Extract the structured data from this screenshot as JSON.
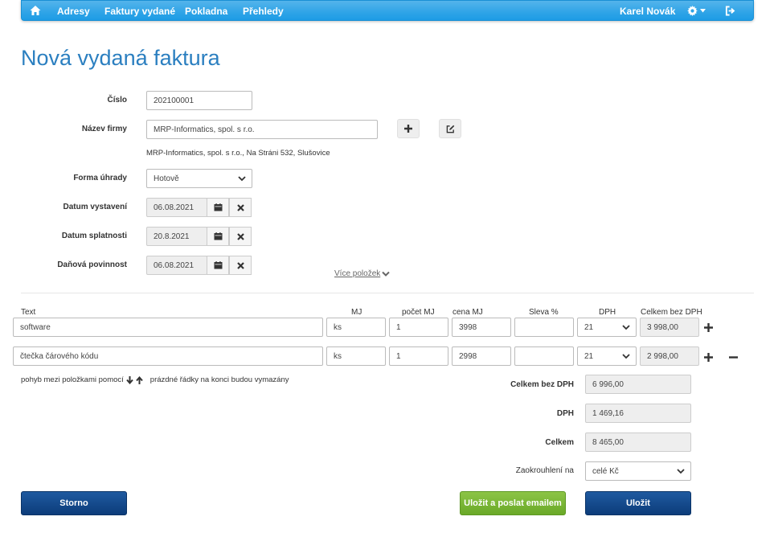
{
  "navbar": {
    "items": [
      {
        "label": "Adresy"
      },
      {
        "label": "Faktury vydané"
      },
      {
        "label": "Pokladna"
      },
      {
        "label": "Přehledy"
      }
    ],
    "user_name": "Karel Novák",
    "icons": {
      "home": "home-icon",
      "settings": "gear-icon",
      "logout": "logout-icon"
    }
  },
  "page": {
    "title": "Nová vydaná faktura"
  },
  "form": {
    "cislo": {
      "label": "Číslo",
      "value": "202100001"
    },
    "nazev_firmy": {
      "label": "Název firmy",
      "value": "MRP-Informatics, spol. s  r.o."
    },
    "address_line": "MRP-Informatics, spol. s r.o., Na Stráni 532, Slušovice",
    "forma_uhrady": {
      "label": "Forma úhrady",
      "value": "Hotově"
    },
    "datum_vystaveni": {
      "label": "Datum vystavení",
      "value": "06.08.2021"
    },
    "datum_splatnosti": {
      "label": "Datum splatnosti",
      "value": "20.8.2021"
    },
    "danova_povinnost": {
      "label": "Daňová povinnost",
      "value": "06.08.2021"
    },
    "more_items_link": "Více položek"
  },
  "items_table": {
    "headers": {
      "text": "Text",
      "mj": "MJ",
      "pocet_mj": "počet MJ",
      "cena_mj": "cena MJ",
      "sleva": "Sleva %",
      "dph": "DPH",
      "celkem_bez_dph": "Celkem bez DPH"
    },
    "rows": [
      {
        "text": "software",
        "mj": "ks",
        "pocet": "1",
        "cena": "3998",
        "sleva": "",
        "dph": "21",
        "celkem": "3 998,00"
      },
      {
        "text": "čtečka čárového kódu",
        "mj": "ks",
        "pocet": "1",
        "cena": "2998",
        "sleva": "",
        "dph": "21",
        "celkem": "2 998,00"
      }
    ],
    "hint_part1": "pohyb mezi položkami pomocí",
    "hint_part2": "prázdné řádky na konci budou vymazány"
  },
  "totals": {
    "celkem_bez_dph": {
      "label": "Celkem bez DPH",
      "value": "6 996,00"
    },
    "dph": {
      "label": "DPH",
      "value": "1 469,16"
    },
    "celkem": {
      "label": "Celkem",
      "value": "8 465,00"
    },
    "zaokrouhleni": {
      "label": "Zaokrouhlení na",
      "value": "celé Kč"
    }
  },
  "buttons": {
    "storno": "Storno",
    "ulozit_email": "Uložit a poslat emailem",
    "ulozit": "Uložit"
  },
  "colors": {
    "navbar": "#2fa4e7",
    "title": "#2b7fc0",
    "primary_button": "#0c3c7a",
    "success_button": "#6aa928"
  }
}
